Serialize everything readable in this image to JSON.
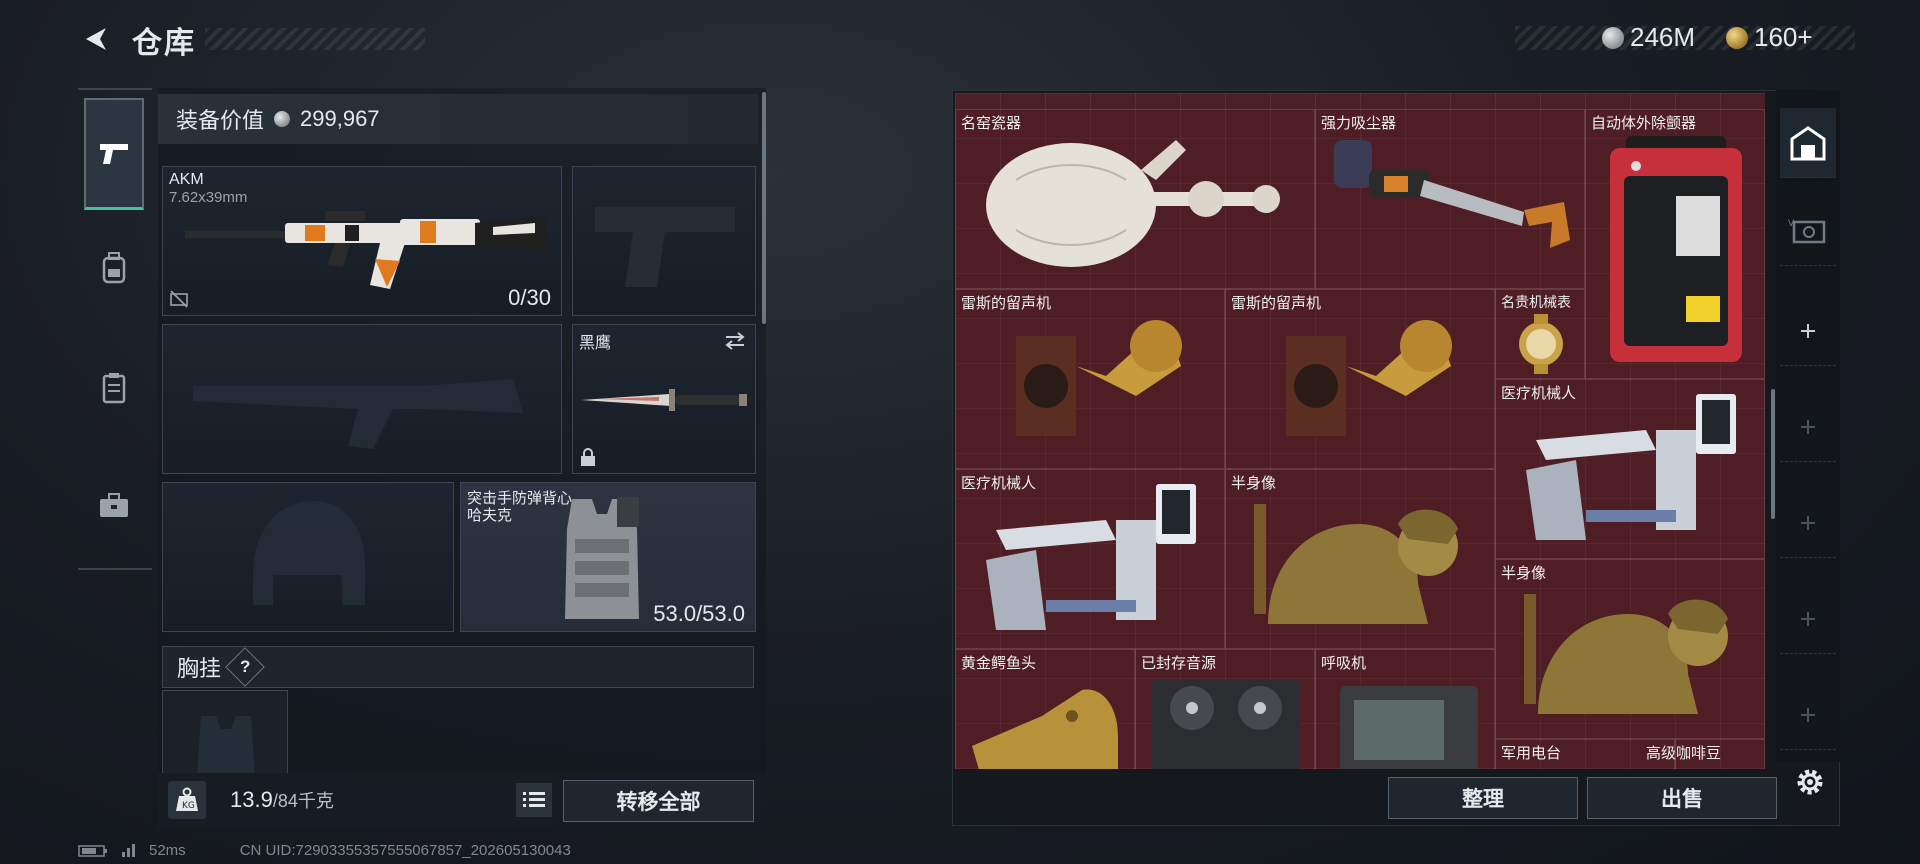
{
  "header": {
    "title": "仓库"
  },
  "currencies": [
    {
      "icon": "silver-coin-icon",
      "value": "246M"
    },
    {
      "icon": "gold-coin-icon",
      "value": "160+"
    }
  ],
  "equipment": {
    "value_label": "装备价值",
    "value": "299,967",
    "primary_weapon": {
      "name": "AKM",
      "caliber": "7.62x39mm",
      "ammo": "0/30"
    },
    "melee": {
      "name": "黑鹰"
    },
    "armor": {
      "name": "突击手防弹背心",
      "sub": "哈夫克",
      "durability": "53.0/53.0"
    },
    "chest_rig": {
      "label": "胸挂",
      "hint": "?"
    },
    "weight": {
      "current": "13.9",
      "max": "/84千克"
    },
    "transfer_all": "转移全部"
  },
  "stash": {
    "items": [
      {
        "label": "名窑瓷器",
        "icon": "porcelain-vase-icon"
      },
      {
        "label": "强力吸尘器",
        "icon": "vacuum-cleaner-icon"
      },
      {
        "label": "自动体外除颤器",
        "icon": "aed-icon"
      },
      {
        "label": "雷斯的留声机",
        "icon": "gramophone-icon"
      },
      {
        "label": "雷斯的留声机",
        "icon": "gramophone-icon"
      },
      {
        "label": "名贵机械表",
        "icon": "watch-icon"
      },
      {
        "label": "医疗机械人",
        "icon": "medical-robot-icon"
      },
      {
        "label": "医疗机械人",
        "icon": "medical-robot-icon"
      },
      {
        "label": "半身像",
        "icon": "bust-statue-icon"
      },
      {
        "label": "半身像",
        "icon": "bust-statue-icon"
      },
      {
        "label": "黄金鳄鱼头",
        "icon": "gold-crocodile-head-icon"
      },
      {
        "label": "已封存音源",
        "icon": "reel-to-reel-icon"
      },
      {
        "label": "呼吸机",
        "icon": "ventilator-icon"
      },
      {
        "label": "军用电台",
        "icon": "radio-icon"
      },
      {
        "label": "高级咖啡豆",
        "icon": "coffee-beans-icon"
      }
    ],
    "sort": "整理",
    "sell": "出售"
  },
  "status": {
    "ping": "52ms",
    "uid": "CN UID:72903355357555067857_202605130043"
  }
}
